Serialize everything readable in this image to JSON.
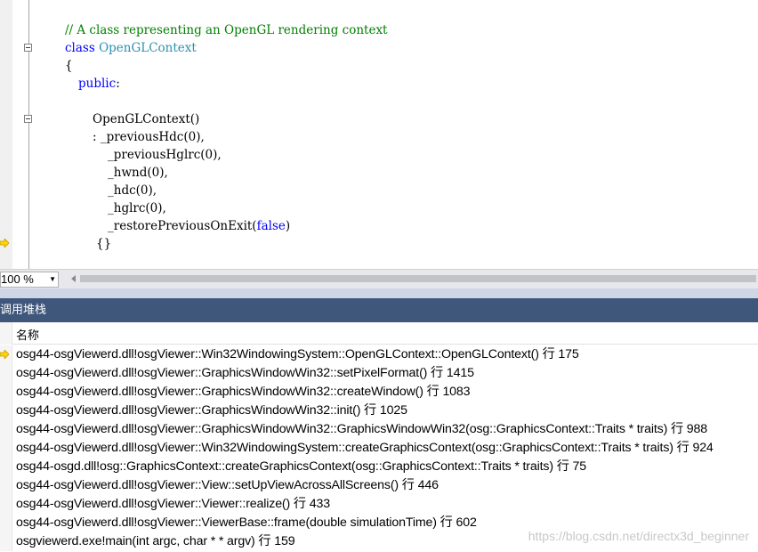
{
  "editor": {
    "lines": [
      {
        "segments": [
          {
            "text": "// A class representing an OpenGL rendering context",
            "style": "cm"
          }
        ]
      },
      {
        "segments": [
          {
            "text": "class ",
            "style": "kw"
          },
          {
            "text": "OpenGLContext",
            "style": "ty"
          }
        ]
      },
      {
        "segments": [
          {
            "text": "{",
            "style": ""
          }
        ]
      },
      {
        "segments": [
          {
            "text": "public",
            "style": "kw"
          },
          {
            "text": ":",
            "style": ""
          }
        ]
      },
      {
        "segments": [
          {
            "text": "",
            "style": ""
          }
        ]
      },
      {
        "segments": [
          {
            "text": "OpenGLContext()",
            "style": ""
          }
        ]
      },
      {
        "segments": [
          {
            "text": ": _previousHdc(0),",
            "style": ""
          }
        ]
      },
      {
        "segments": [
          {
            "text": "_previousHglrc(0),",
            "style": ""
          }
        ]
      },
      {
        "segments": [
          {
            "text": "_hwnd(0),",
            "style": ""
          }
        ]
      },
      {
        "segments": [
          {
            "text": "_hdc(0),",
            "style": ""
          }
        ]
      },
      {
        "segments": [
          {
            "text": "_hglrc(0),",
            "style": ""
          }
        ]
      },
      {
        "segments": [
          {
            "text": "_restorePreviousOnExit(",
            "style": ""
          },
          {
            "text": "false",
            "style": "kw"
          },
          {
            "text": ")",
            "style": ""
          }
        ]
      },
      {
        "segments": [
          {
            "text": "{}",
            "style": ""
          }
        ]
      }
    ],
    "current_line_index": 12,
    "colors": {
      "keyword": "#0000ff",
      "type": "#2b91af",
      "comment": "#008000"
    }
  },
  "zoom": {
    "value": "100 %"
  },
  "callstack": {
    "title": "调用堆栈",
    "column_header": "名称",
    "current_frame_index": 0,
    "frames": [
      "osg44-osgViewerd.dll!osgViewer::Win32WindowingSystem::OpenGLContext::OpenGLContext() 行 175",
      "osg44-osgViewerd.dll!osgViewer::GraphicsWindowWin32::setPixelFormat() 行 1415",
      "osg44-osgViewerd.dll!osgViewer::GraphicsWindowWin32::createWindow() 行 1083",
      "osg44-osgViewerd.dll!osgViewer::GraphicsWindowWin32::init() 行 1025",
      "osg44-osgViewerd.dll!osgViewer::GraphicsWindowWin32::GraphicsWindowWin32(osg::GraphicsContext::Traits * traits) 行 988",
      "osg44-osgViewerd.dll!osgViewer::Win32WindowingSystem::createGraphicsContext(osg::GraphicsContext::Traits * traits) 行 924",
      "osg44-osgd.dll!osg::GraphicsContext::createGraphicsContext(osg::GraphicsContext::Traits * traits) 行 75",
      "osg44-osgViewerd.dll!osgViewer::View::setUpViewAcrossAllScreens() 行 446",
      "osg44-osgViewerd.dll!osgViewer::Viewer::realize() 行 433",
      "osg44-osgViewerd.dll!osgViewer::ViewerBase::frame(double simulationTime) 行 602",
      "osgviewerd.exe!main(int argc, char * * argv) 行 159"
    ],
    "title_bar_color": "#40577c"
  },
  "watermark": "https://blog.csdn.net/directx3d_beginner",
  "icons": {
    "current_line": "arrow-right-icon",
    "fold": "collapse-box-icon"
  }
}
